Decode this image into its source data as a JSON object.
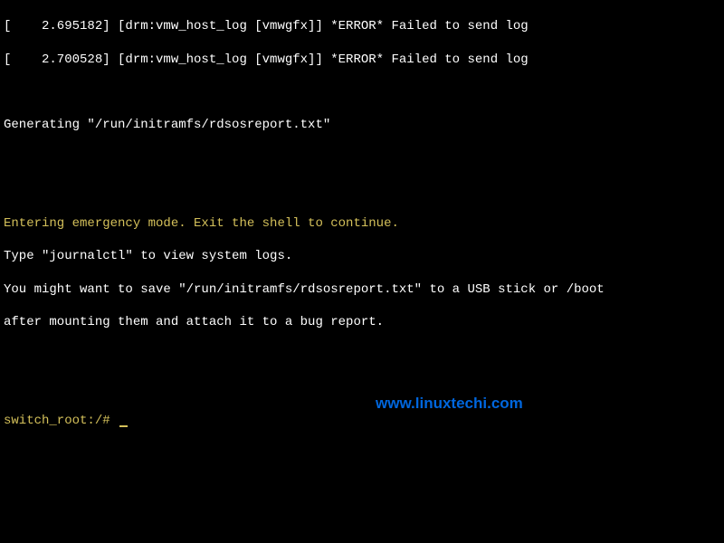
{
  "kernel_log": {
    "line1": "[    2.695182] [drm:vmw_host_log [vmwgfx]] *ERROR* Failed to send log",
    "line2": "[    2.700528] [drm:vmw_host_log [vmwgfx]] *ERROR* Failed to send log"
  },
  "generating": "Generating \"/run/initramfs/rdsosreport.txt\"",
  "emergency": {
    "line1": "Entering emergency mode. Exit the shell to continue.",
    "line2": "Type \"journalctl\" to view system logs.",
    "line3": "You might want to save \"/run/initramfs/rdsosreport.txt\" to a USB stick or /boot",
    "line4": "after mounting them and attach it to a bug report."
  },
  "prompt": "switch_root:/# ",
  "watermark": "www.linuxtechi.com"
}
